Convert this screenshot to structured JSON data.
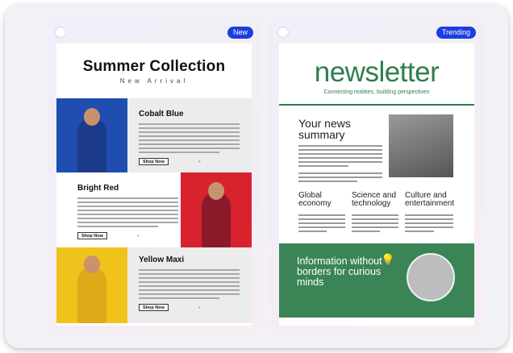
{
  "left_card": {
    "badge": "New",
    "title": "Summer Collection",
    "subtitle": "New Arrival",
    "products": [
      {
        "name": "Cobalt Blue",
        "button": "Shop Now"
      },
      {
        "name": "Bright Red",
        "button": "Shop Now"
      },
      {
        "name": "Yellow Maxi",
        "button": "Shop Now"
      }
    ]
  },
  "right_card": {
    "badge": "Trending",
    "title": "newsletter",
    "subtitle": "Connecting realities, building perspectives",
    "summary_heading": "Your news summary",
    "columns": [
      {
        "heading": "Global economy"
      },
      {
        "heading": "Science and technology"
      },
      {
        "heading": "Culture and entertainment"
      }
    ],
    "banner_heading": "Information without borders for curious minds"
  },
  "colors": {
    "badge": "#1a3fe0",
    "newsletter_green": "#2f7d4e",
    "banner_green": "#3b8456"
  }
}
